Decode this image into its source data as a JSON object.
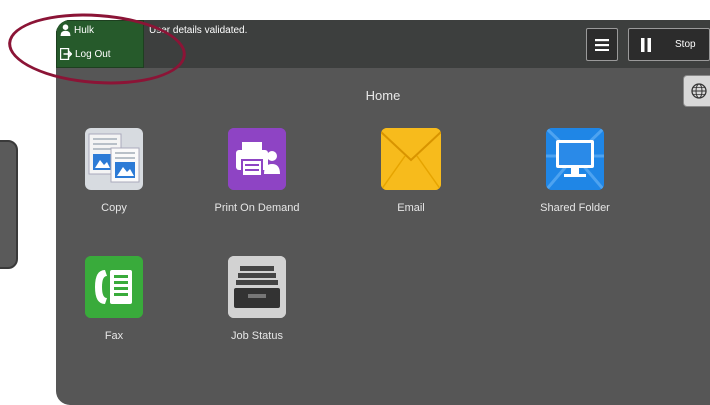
{
  "user": {
    "name": "Hulk",
    "logout_label": "Log Out"
  },
  "status_message": "User details validated.",
  "controls": {
    "menu_icon": "hamburger-icon",
    "stop_label": "Stop",
    "pause_icon": "pause-icon",
    "language_icon": "globe-icon"
  },
  "home": {
    "title": "Home"
  },
  "apps": [
    {
      "label": "Copy",
      "icon": "copy-icon"
    },
    {
      "label": "Print On Demand",
      "icon": "print-on-demand-icon"
    },
    {
      "label": "Email",
      "icon": "email-icon"
    },
    {
      "label": "Shared Folder",
      "icon": "shared-folder-icon"
    },
    {
      "label": "Fax",
      "icon": "fax-icon"
    },
    {
      "label": "Job Status",
      "icon": "job-status-icon"
    }
  ],
  "colors": {
    "annotation": "#8b1436",
    "user_panel": "#265a2b",
    "screen": "#565656"
  }
}
